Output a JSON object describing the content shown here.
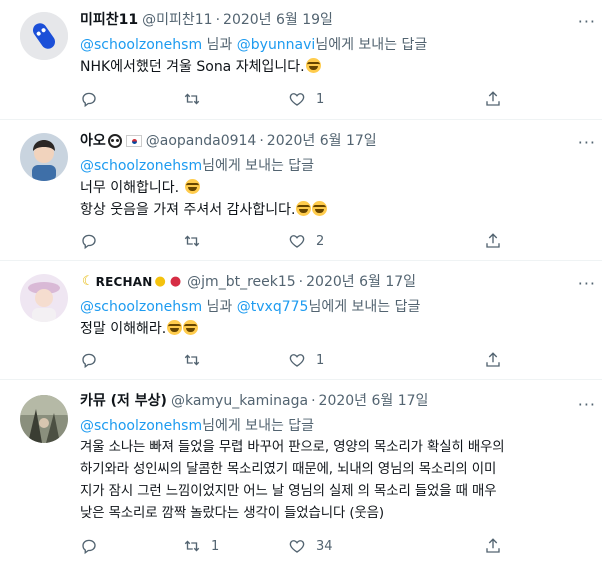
{
  "tweets": [
    {
      "name": "미피찬11",
      "handle": "@미피찬11",
      "date": "2020년 6월 19일",
      "reply_prefix": "@schoolzonehsm",
      "reply_mid": " 님과 ",
      "reply_second": "@byunnavi",
      "reply_suffix": "님에게 보내는 답글",
      "lines": [
        "NHK에서했던 겨울 Sona 자체입니다."
      ],
      "counts": {
        "reply": "",
        "retweet": "",
        "like": "1",
        "share": ""
      }
    },
    {
      "name": "아오",
      "handle": "@aopanda0914",
      "date": "2020년 6월 17일",
      "reply_prefix": "@schoolzonehsm",
      "reply_suffix": "님에게 보내는 답글",
      "lines": [
        "너무 이해합니다.",
        "항상 웃음을 가져 주셔서 감사합니다."
      ],
      "counts": {
        "reply": "",
        "retweet": "",
        "like": "2",
        "share": ""
      }
    },
    {
      "name": "RECHAN",
      "handle": "@jm_bt_reek15",
      "date": "2020년 6월 17일",
      "reply_prefix": "@schoolzonehsm",
      "reply_mid": " 님과 ",
      "reply_second": "@tvxq775",
      "reply_suffix": "님에게 보내는 답글",
      "lines": [
        "정말 이해해라."
      ],
      "counts": {
        "reply": "",
        "retweet": "",
        "like": "1",
        "share": ""
      }
    },
    {
      "name": "카뮤 (저 부상)",
      "handle": "@kamyu_kaminaga",
      "date": "2020년 6월 17일",
      "reply_prefix": "@schoolzonehsm",
      "reply_suffix": "님에게 보내는 답글",
      "lines": [
        "겨울 소나는 빠져 들었을 무렵 바꾸어 판으로, 영양의 목소리가 확실히 배우의",
        "하기와라 성인씨의 달콤한 목소리였기 때문에, 뇌내의 영님의 목소리의 이미",
        "지가 잠시 그런 느낌이었지만 어느 날 영님의 실제 의 목소리 들었을 때 매우",
        "낮은 목소리로 깜짝 놀랐다는 생각이 들었습니다 (웃음)"
      ],
      "counts": {
        "reply": "",
        "retweet": "1",
        "like": "34",
        "share": ""
      }
    }
  ],
  "icons": [
    "more-icon",
    "reply-icon",
    "retweet-icon",
    "like-icon",
    "share-icon"
  ],
  "colors": {
    "mention": "#1d9bf0",
    "secondary": "#536471",
    "text": "#0f1419"
  }
}
